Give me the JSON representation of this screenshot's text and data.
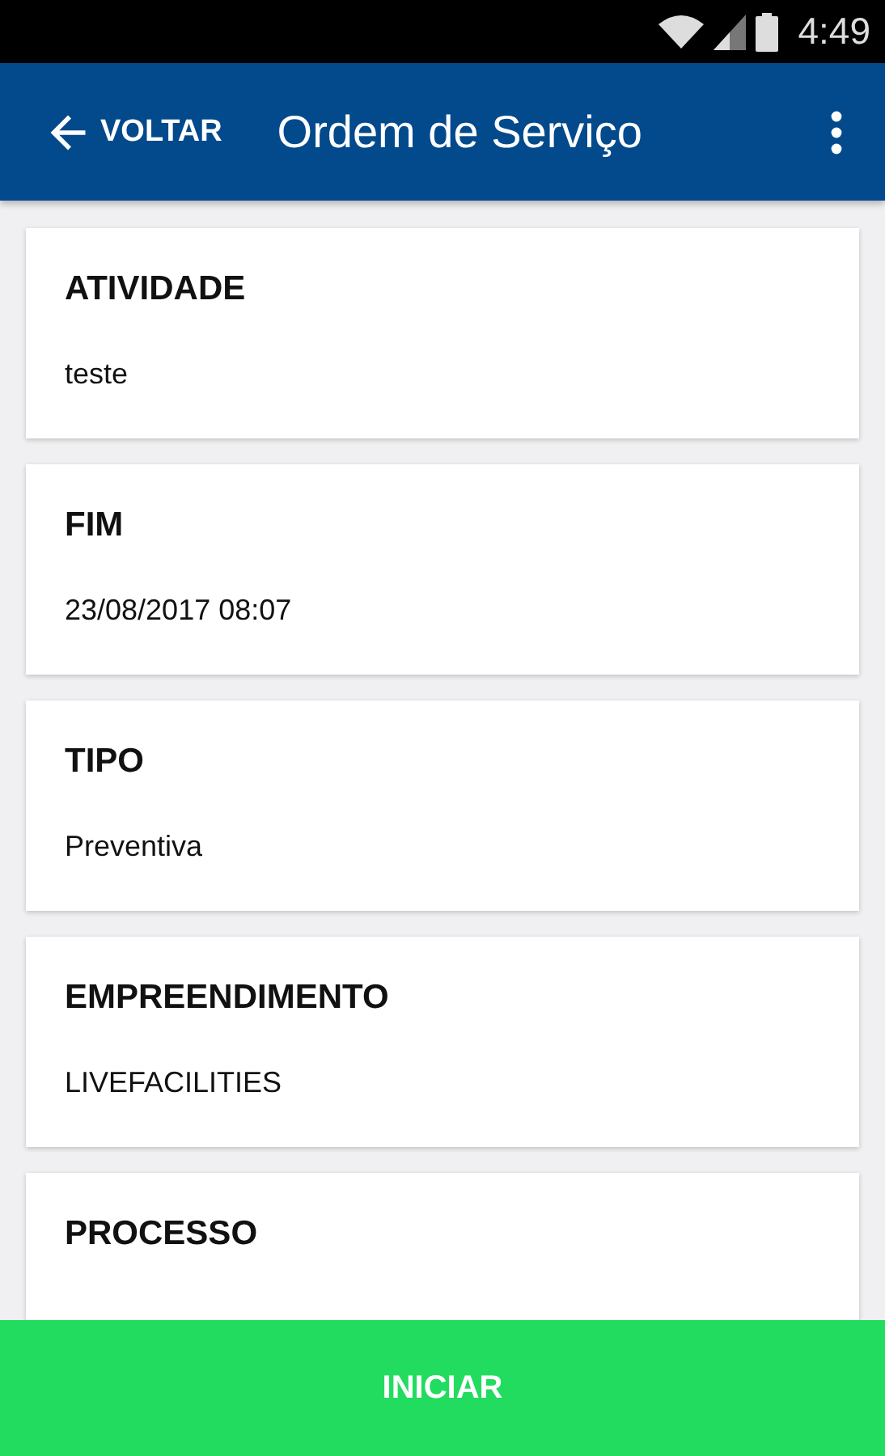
{
  "status_bar": {
    "time": "4:49"
  },
  "app_bar": {
    "back_label": "VOLTAR",
    "title": "Ordem de Serviço"
  },
  "fields": [
    {
      "label": "ATIVIDADE",
      "value": "teste"
    },
    {
      "label": "FIM",
      "value": "23/08/2017 08:07"
    },
    {
      "label": "TIPO",
      "value": "Preventiva"
    },
    {
      "label": "EMPREENDIMENTO",
      "value": "LIVEFACILITIES"
    },
    {
      "label": "PROCESSO"
    }
  ],
  "action_button": "INICIAR"
}
